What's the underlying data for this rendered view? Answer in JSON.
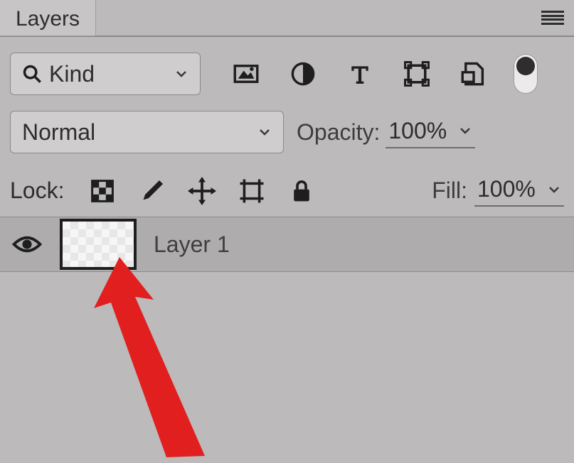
{
  "panel": {
    "title": "Layers"
  },
  "filter": {
    "kind_label": "Kind",
    "icons": {
      "pixel": "pixel-layer-filter-icon",
      "adjustment": "adjustment-layer-filter-icon",
      "type": "type-layer-filter-icon",
      "shape": "shape-layer-filter-icon",
      "smart": "smart-object-filter-icon"
    }
  },
  "blend": {
    "mode": "Normal",
    "opacity_label": "Opacity:",
    "opacity_value": "100%"
  },
  "lock": {
    "label": "Lock:",
    "fill_label": "Fill:",
    "fill_value": "100%"
  },
  "layers": [
    {
      "name": "Layer 1",
      "visible": true
    }
  ]
}
